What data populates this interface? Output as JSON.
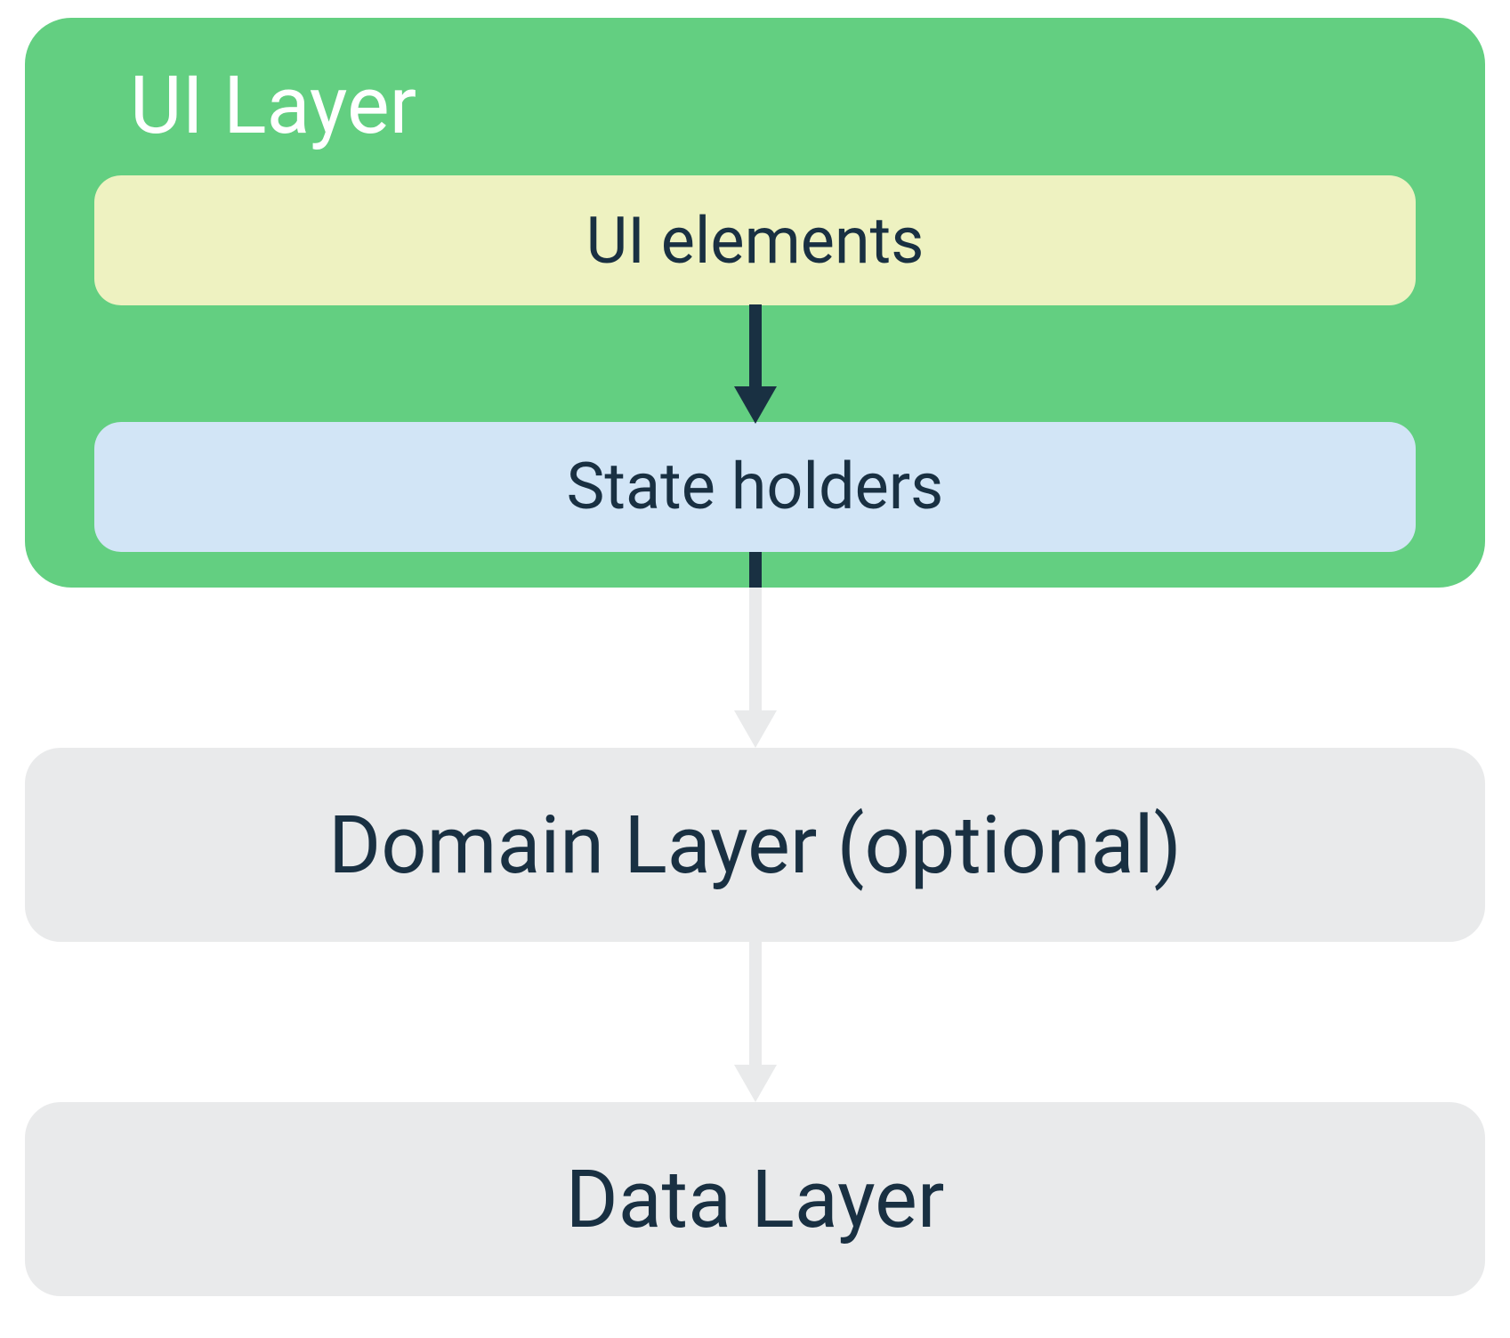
{
  "colors": {
    "ui_layer_bg": "#63cf81",
    "ui_elements_bg": "#eef2c1",
    "state_holders_bg": "#d2e5f6",
    "layer_box_bg": "#e9eaeb",
    "text_dark": "#193042",
    "text_light": "#ffffff",
    "arrow_dark": "#193042",
    "arrow_light": "#e9eaeb"
  },
  "ui_layer": {
    "title": "UI Layer",
    "ui_elements_label": "UI elements",
    "state_holders_label": "State holders"
  },
  "domain_layer": {
    "label": "Domain Layer (optional)"
  },
  "data_layer": {
    "label": "Data Layer"
  }
}
